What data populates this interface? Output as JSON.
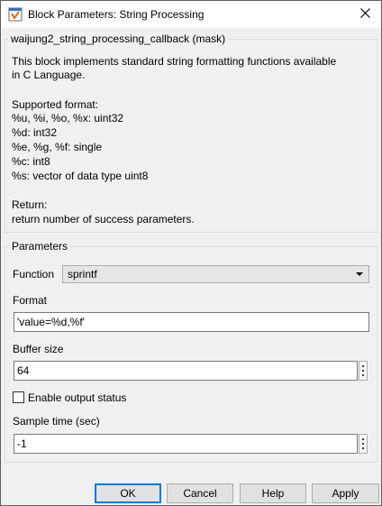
{
  "window": {
    "title": "Block Parameters: String Processing"
  },
  "mask": {
    "legend": "waijung2_string_processing_callback (mask)",
    "description_lines": [
      "This block implements standard string formatting functions available",
      "in C Language.",
      "",
      "Supported format:",
      "%u, %i, %o, %x: uint32",
      "%d: int32",
      "%e, %g, %f: single",
      "%c: int8",
      "%s: vector of data type uint8",
      "",
      "Return:",
      "return number of success parameters."
    ]
  },
  "parameters": {
    "legend": "Parameters",
    "function": {
      "label": "Function",
      "value": "sprintf"
    },
    "format": {
      "label": "Format",
      "value": "'value=%d,%f'"
    },
    "buffer_size": {
      "label": "Buffer size",
      "value": "64"
    },
    "enable_output_status": {
      "label": "Enable output status",
      "checked": false
    },
    "sample_time": {
      "label": "Sample time (sec)",
      "value": "-1"
    }
  },
  "buttons": {
    "ok": "OK",
    "cancel": "Cancel",
    "help": "Help",
    "apply": "Apply"
  },
  "colors": {
    "accent": "#0078d7",
    "dialog_background": "#f0f0f0",
    "titlebar_background": "#ffffff"
  }
}
